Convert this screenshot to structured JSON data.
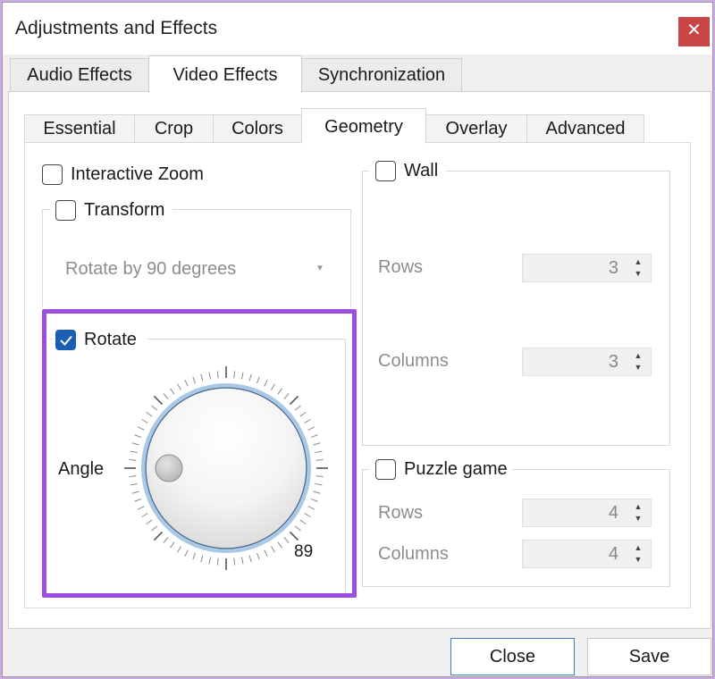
{
  "window": {
    "title": "Adjustments and Effects",
    "close_glyph": "✕"
  },
  "main_tabs": [
    {
      "label": "Audio Effects"
    },
    {
      "label": "Video Effects"
    },
    {
      "label": "Synchronization"
    }
  ],
  "sub_tabs": [
    {
      "label": "Essential"
    },
    {
      "label": "Crop"
    },
    {
      "label": "Colors"
    },
    {
      "label": "Geometry"
    },
    {
      "label": "Overlay"
    },
    {
      "label": "Advanced"
    }
  ],
  "geometry": {
    "interactive_zoom": {
      "label": "Interactive Zoom",
      "checked": false
    },
    "transform": {
      "label": "Transform",
      "checked": false,
      "combo_value": "Rotate by 90 degrees"
    },
    "rotate": {
      "label": "Rotate",
      "checked": true,
      "angle_label": "Angle",
      "angle_value": "89"
    },
    "wall": {
      "label": "Wall",
      "checked": false,
      "rows_label": "Rows",
      "rows_value": "3",
      "columns_label": "Columns",
      "columns_value": "3"
    },
    "puzzle": {
      "label": "Puzzle game",
      "checked": false,
      "rows_label": "Rows",
      "rows_value": "4",
      "columns_label": "Columns",
      "columns_value": "4"
    }
  },
  "buttons": {
    "close_label": "Close",
    "save_label": "Save"
  },
  "colors": {
    "highlight": "#9b4ee0",
    "accent": "#1a5fb4",
    "close_button": "#c94646"
  }
}
